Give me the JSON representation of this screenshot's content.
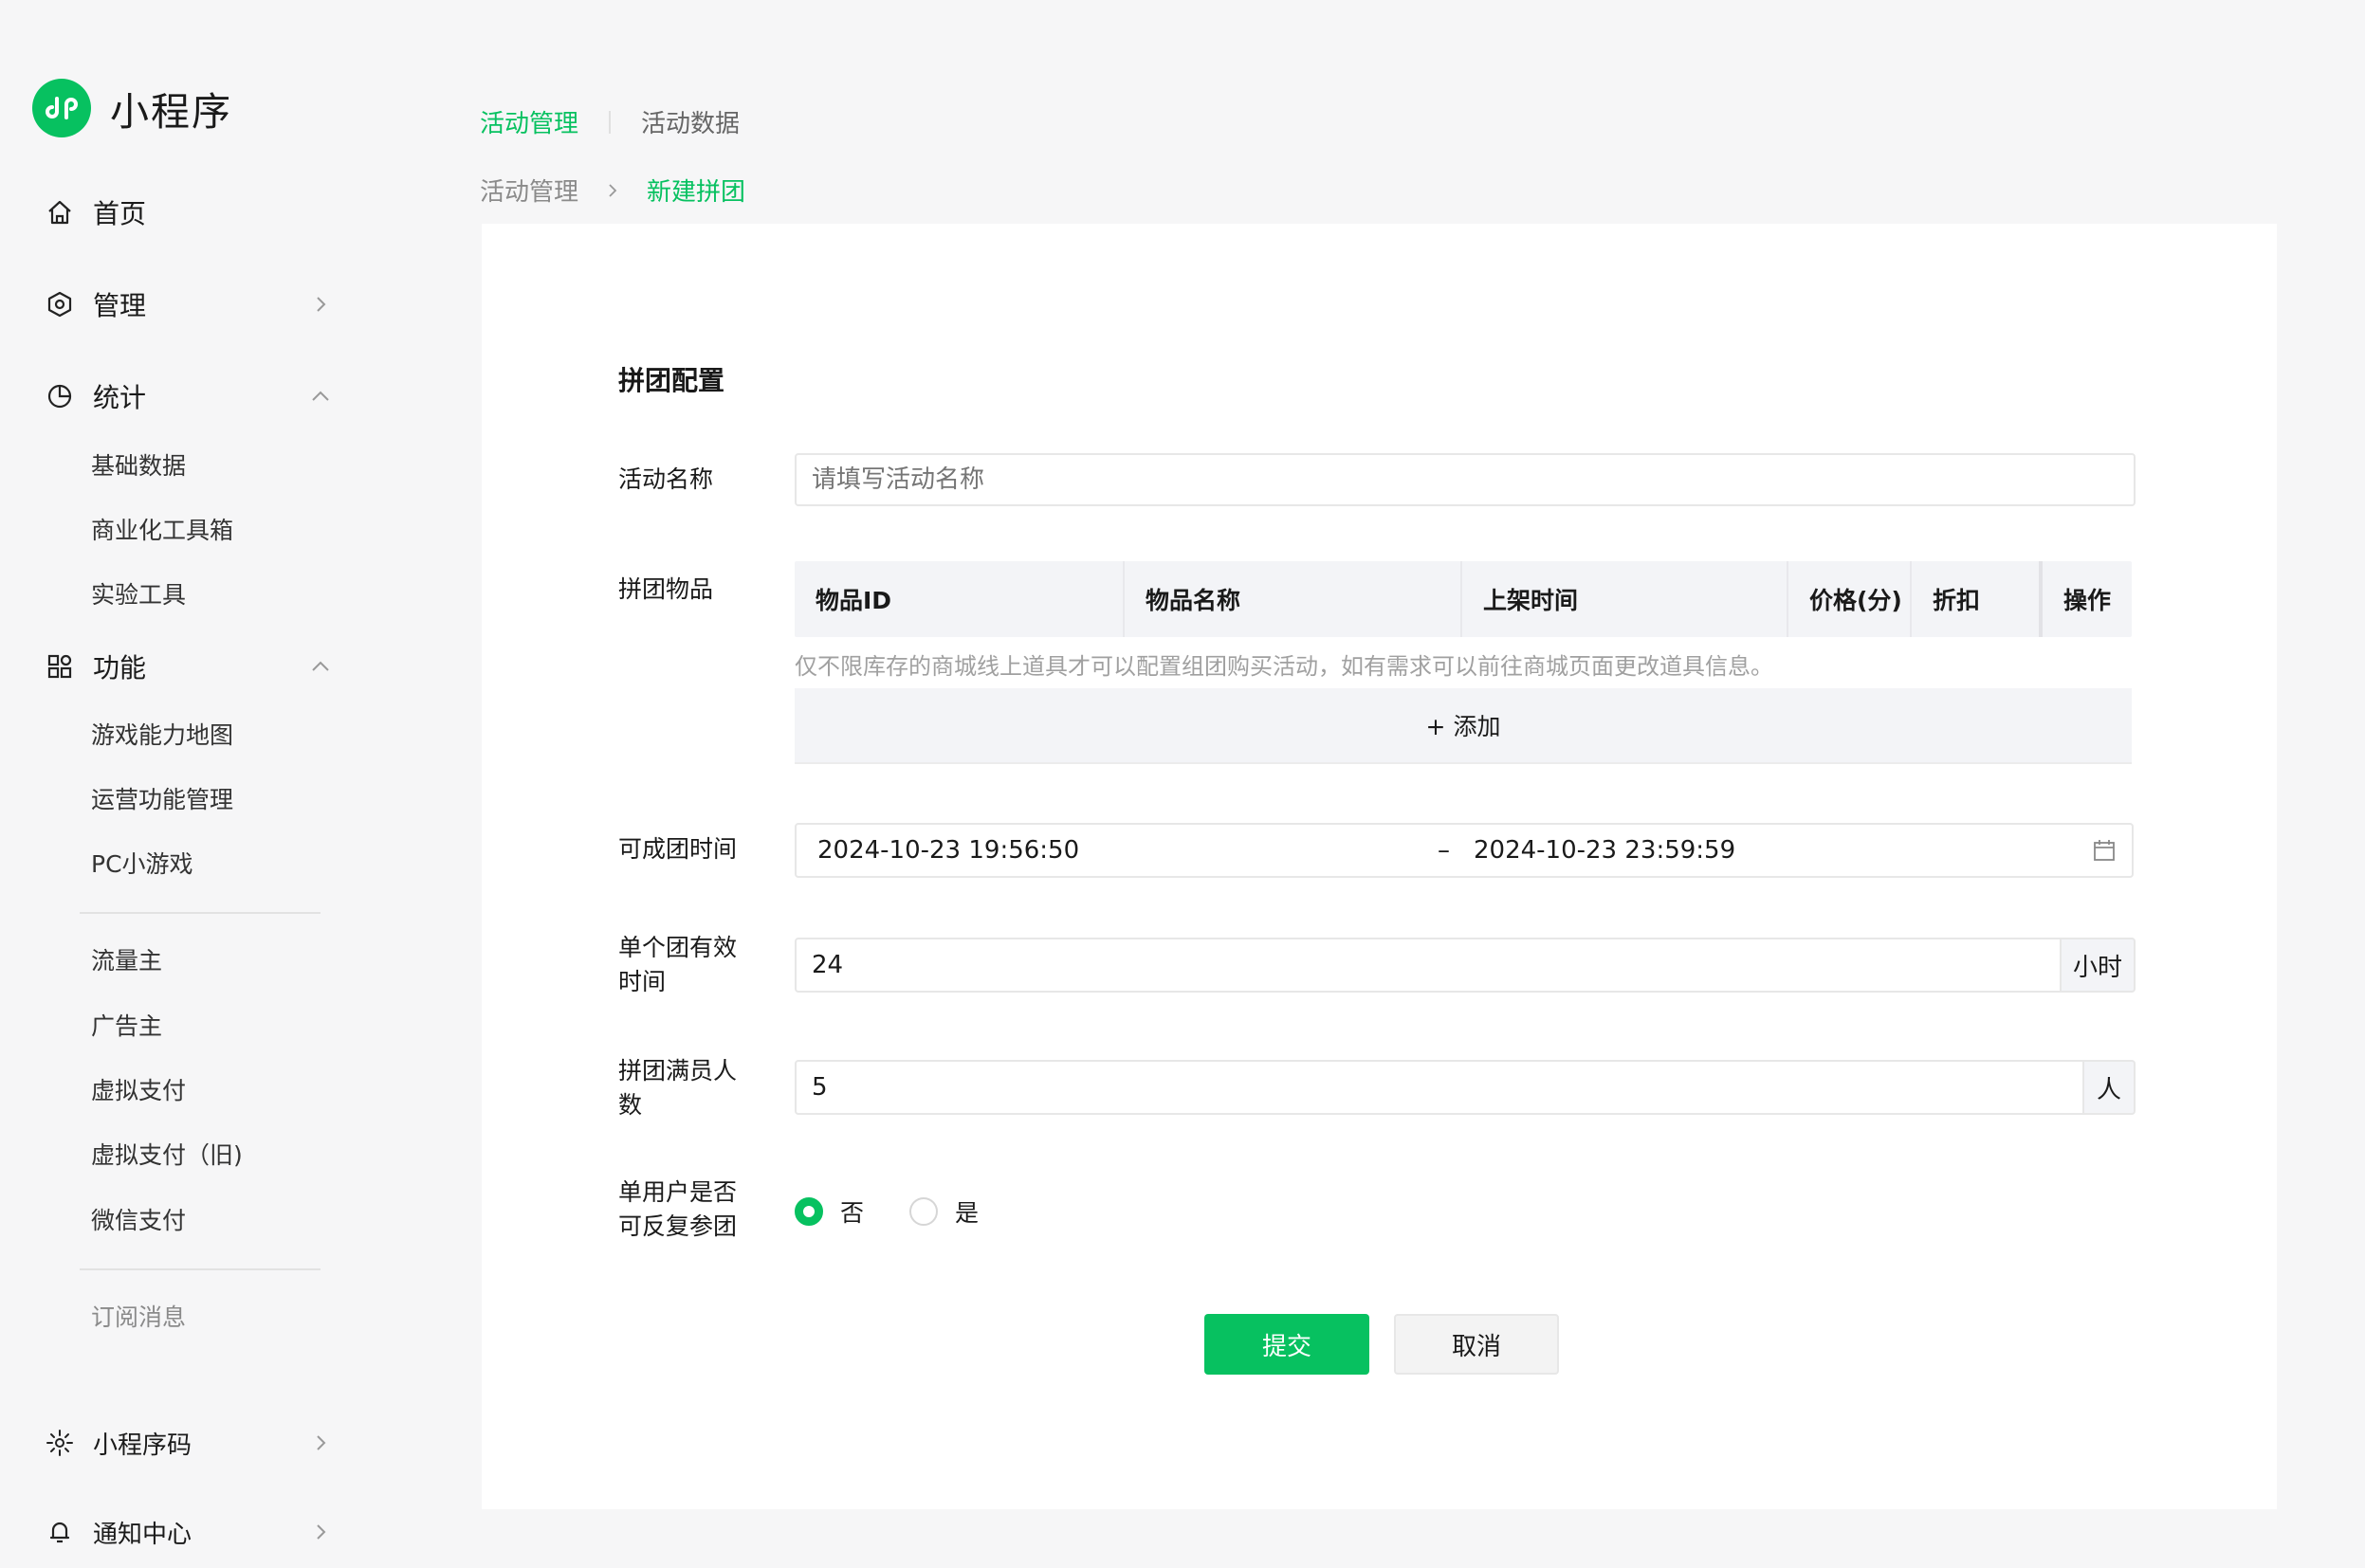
{
  "sidebar": {
    "brand_name": "小程序",
    "nav": [
      {
        "label": "首页",
        "icon": "home-icon"
      },
      {
        "label": "管理",
        "icon": "settings-hexagon-icon"
      },
      {
        "label": "统计",
        "icon": "pie-chart-icon"
      },
      {
        "label": "功能",
        "icon": "grid-apps-icon"
      }
    ],
    "stats_sub": [
      "基础数据",
      "商业化工具箱",
      "实验工具"
    ],
    "function_sub": [
      "游戏能力地图",
      "运营功能管理",
      "PC小游戏"
    ],
    "group2": [
      "流量主",
      "广告主",
      "虚拟支付",
      "虚拟支付（旧)",
      "微信支付"
    ],
    "group3": [
      "订阅消息"
    ],
    "bottom": [
      {
        "label": "小程序码",
        "icon": "qrcode-sun-icon"
      },
      {
        "label": "通知中心",
        "icon": "bell-icon"
      }
    ]
  },
  "tabs": {
    "active": "活动管理",
    "other": "活动数据"
  },
  "breadcrumb": {
    "parent": "活动管理",
    "current": "新建拼团"
  },
  "form": {
    "section_title": "拼团配置",
    "name_label": "活动名称",
    "name_placeholder": "请填写活动名称",
    "items_label": "拼团物品",
    "table_headers": [
      "物品ID",
      "物品名称",
      "上架时间",
      "价格(分)",
      "折扣",
      "操作"
    ],
    "hint": "仅不限库存的商城线上道具才可以配置组团购买活动，如有需求可以前往商城页面更改道具信息。",
    "add_label": "+ 添加",
    "time_label": "可成团时间",
    "start_time": "2024-10-23 19:56:50",
    "range_sep": "–",
    "end_time": "2024-10-23 23:59:59",
    "valid_label_1": "单个团有效",
    "valid_label_2": "时间",
    "valid_value": "24",
    "valid_unit": "小时",
    "full_label_1": "拼团满员人",
    "full_label_2": "数",
    "full_value": "5",
    "full_unit": "人",
    "repeat_label_1": "单用户是否",
    "repeat_label_2": "可反复参团",
    "radio_no": "否",
    "radio_yes": "是",
    "radio_selected": "否",
    "submit": "提交",
    "cancel": "取消"
  },
  "colors": {
    "accent": "#07c160",
    "bg": "#f6f6f7",
    "card": "#ffffff"
  }
}
